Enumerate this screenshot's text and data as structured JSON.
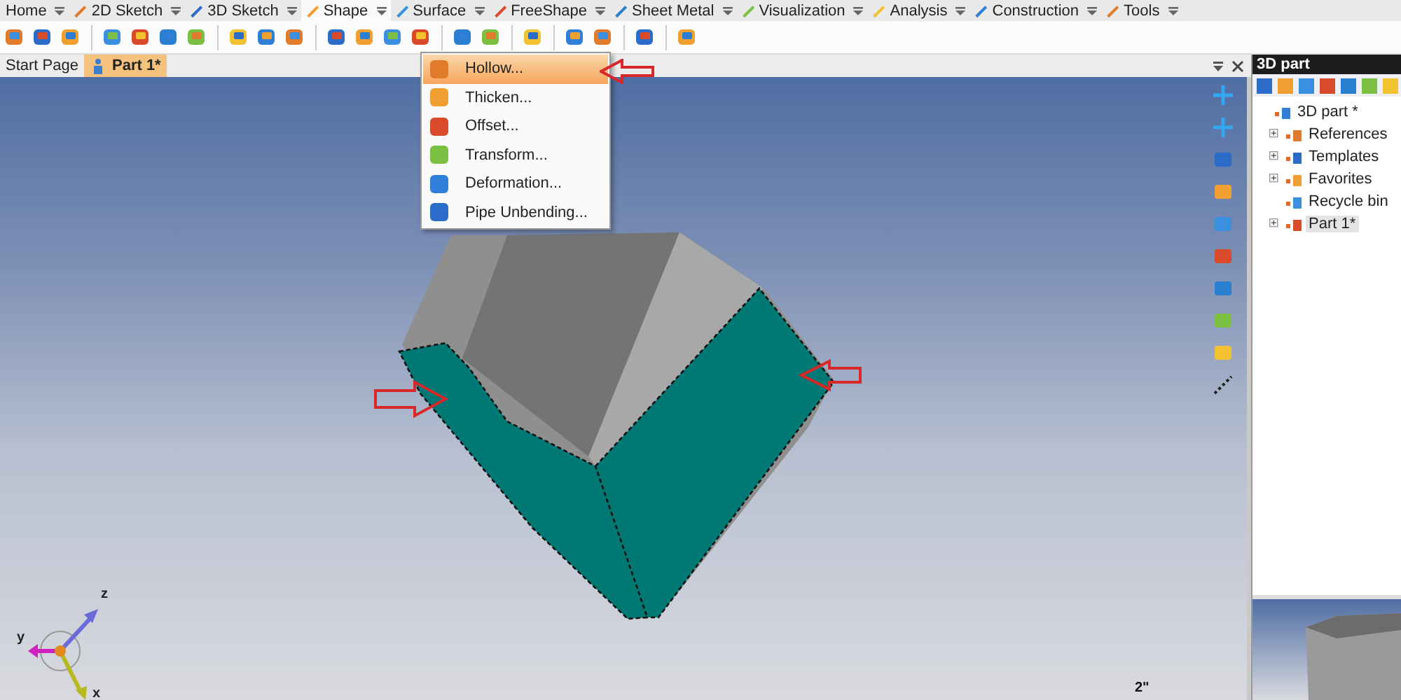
{
  "ribbon_tabs": [
    {
      "label": "Home",
      "selected": false
    },
    {
      "label": "2D Sketch",
      "selected": false
    },
    {
      "label": "3D Sketch",
      "selected": false
    },
    {
      "label": "Shape",
      "selected": true
    },
    {
      "label": "Surface",
      "selected": false
    },
    {
      "label": "FreeShape",
      "selected": false
    },
    {
      "label": "Sheet Metal",
      "selected": false
    },
    {
      "label": "Visualization",
      "selected": false
    },
    {
      "label": "Analysis",
      "selected": false
    },
    {
      "label": "Construction",
      "selected": false
    },
    {
      "label": "Tools",
      "selected": false
    }
  ],
  "document_tabs": [
    {
      "label": "Start Page",
      "selected": false
    },
    {
      "label": "Part 1*",
      "selected": true
    }
  ],
  "dropdown_menu": [
    {
      "label": "Hollow...",
      "selected": true
    },
    {
      "label": "Thicken...",
      "selected": false
    },
    {
      "label": "Offset...",
      "selected": false
    },
    {
      "label": "Transform...",
      "selected": false
    },
    {
      "label": "Deformation...",
      "selected": false
    },
    {
      "label": "Pipe Unbending...",
      "selected": false
    }
  ],
  "viewport": {
    "axes": [
      "z",
      "y",
      "x"
    ],
    "scale_label": "2\""
  },
  "side_panel": {
    "title": "3D part",
    "tree": [
      {
        "label": "3D part *",
        "selected": false,
        "children": [
          {
            "label": "References",
            "expanded": false,
            "selected": false
          },
          {
            "label": "Templates",
            "expanded": false,
            "selected": false
          },
          {
            "label": "Favorites",
            "expanded": false,
            "selected": false
          },
          {
            "label": "Recycle bin",
            "selected": false
          },
          {
            "label": "Part 1*",
            "expanded": false,
            "selected": true
          }
        ]
      }
    ]
  }
}
